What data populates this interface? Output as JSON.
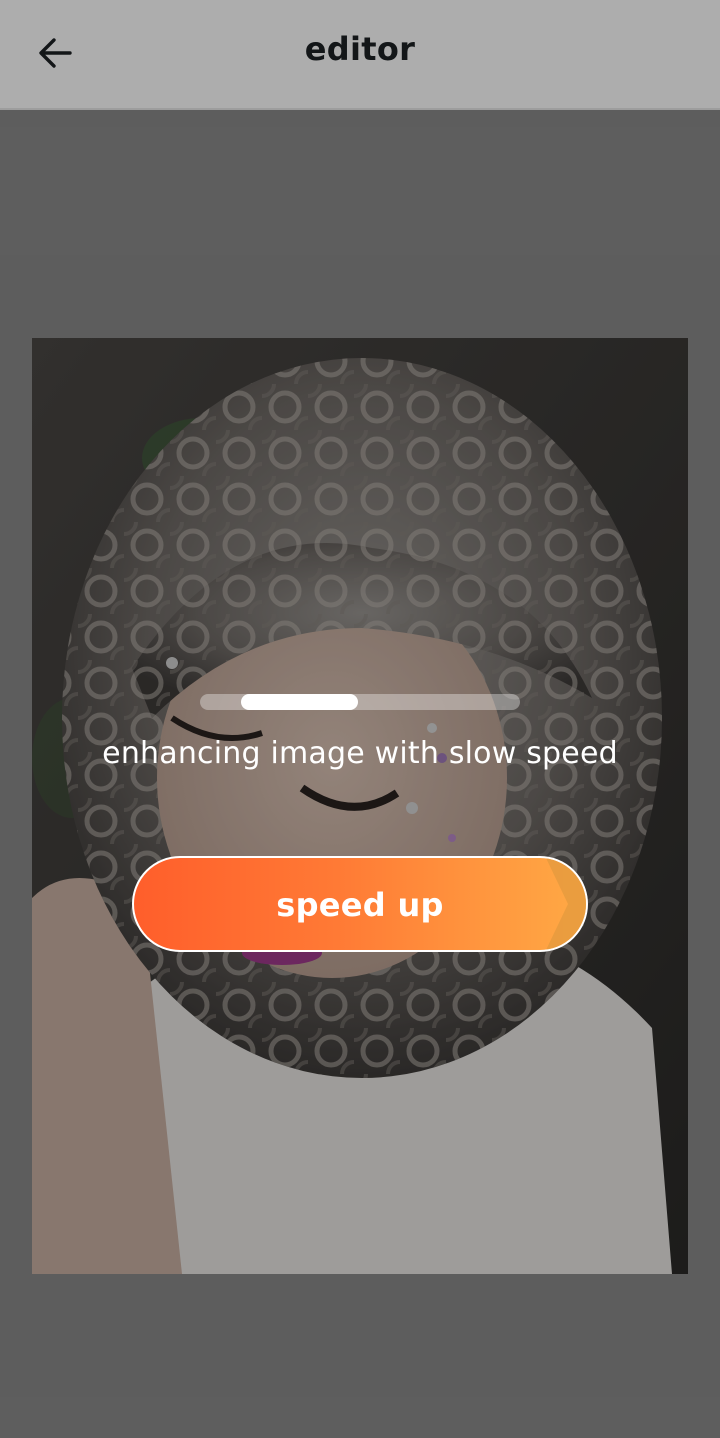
{
  "header": {
    "title": "editor",
    "back_icon": "arrow-left-icon"
  },
  "enhancer": {
    "status_text": "enhancing image with slow speed",
    "progress_indicator": "indeterminate",
    "speed_up_label": "speed up"
  },
  "colors": {
    "button_gradient_start": "#ff5e2b",
    "button_gradient_end": "#ffaa45",
    "header_text": "#1c2124"
  }
}
